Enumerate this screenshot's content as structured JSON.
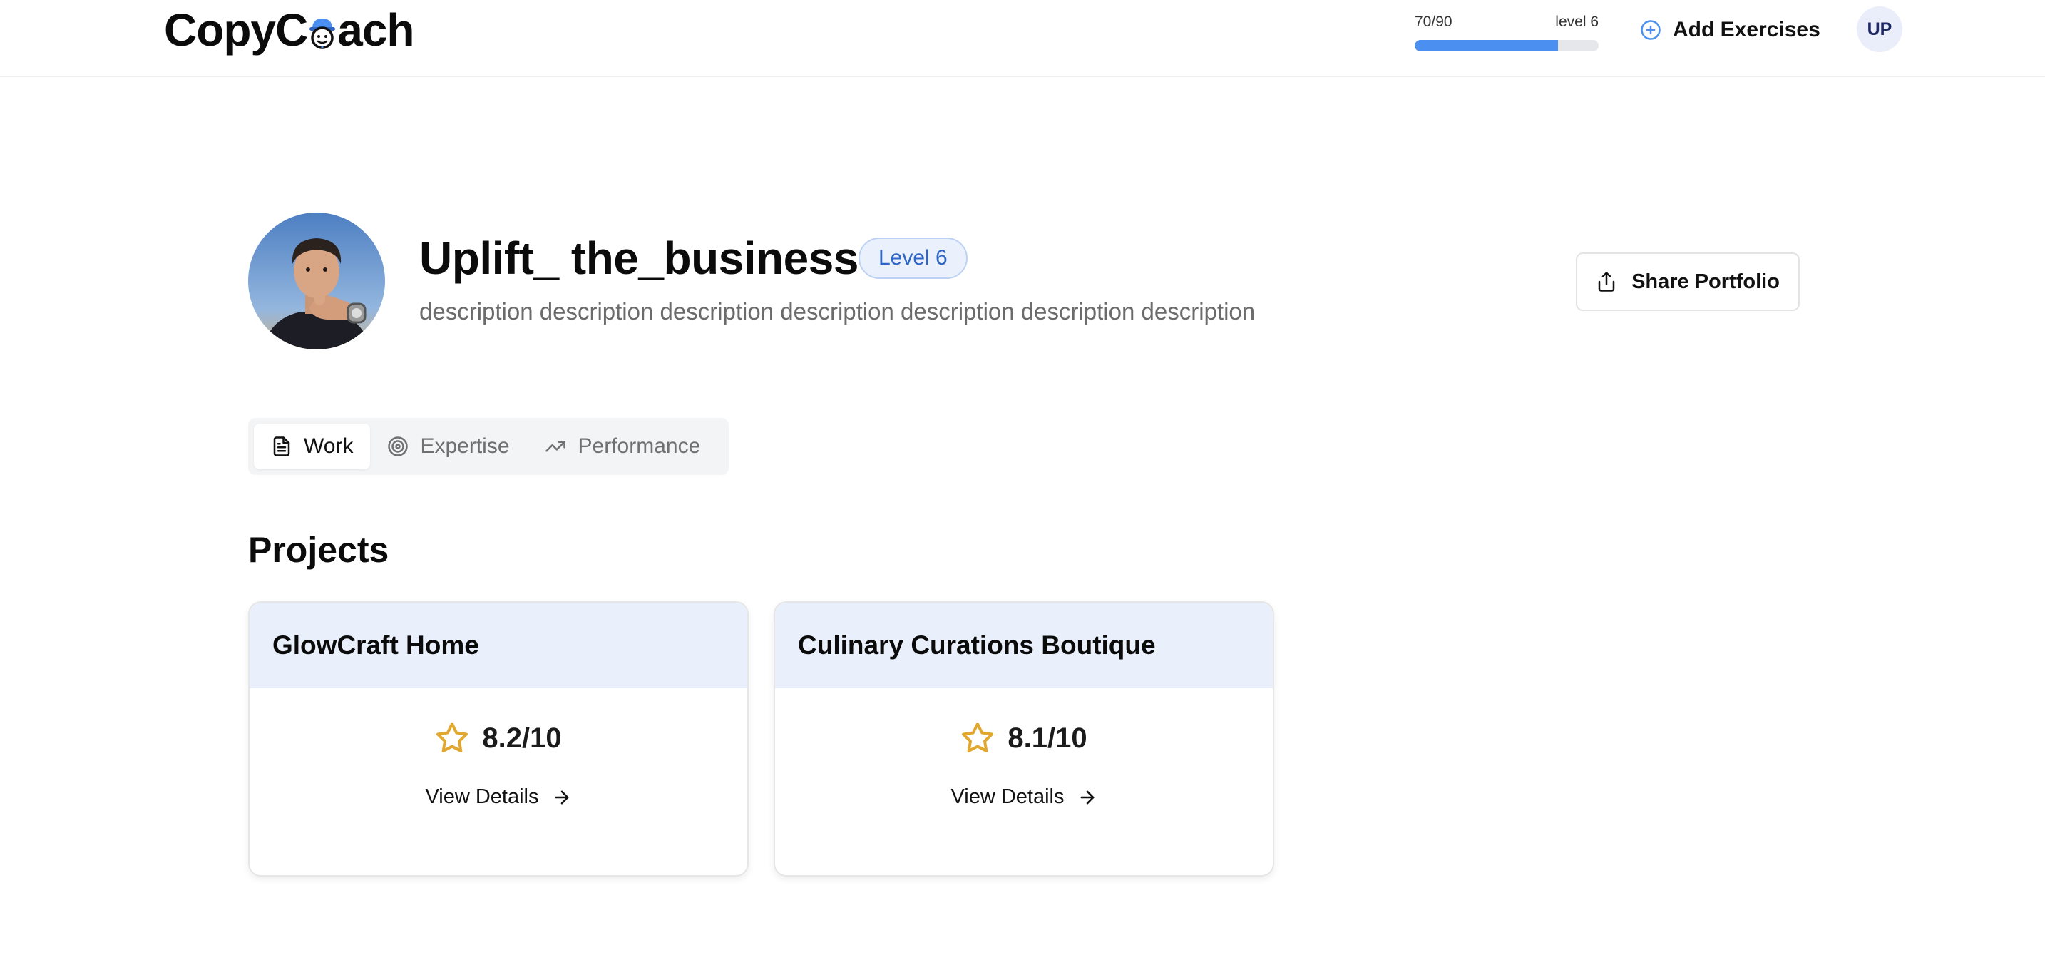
{
  "header": {
    "logo_before": "CopyC",
    "logo_after": "ach",
    "progress": {
      "current_label": "70/90",
      "level_label": "level 6",
      "fraction": 0.78
    },
    "add_exercises_label": "Add Exercises",
    "user_initials": "UP"
  },
  "profile": {
    "name": "Uplift_ the_business",
    "level_badge": "Level 6",
    "description": "description description description description description description description",
    "share_label": "Share Portfolio"
  },
  "tabs": [
    {
      "label": "Work",
      "icon": "document-icon",
      "active": true
    },
    {
      "label": "Expertise",
      "icon": "target-icon",
      "active": false
    },
    {
      "label": "Performance",
      "icon": "trending-up-icon",
      "active": false
    }
  ],
  "projects": {
    "title": "Projects",
    "items": [
      {
        "name": "GlowCraft Home",
        "score": "8.2/10",
        "link_label": "View Details"
      },
      {
        "name": "Culinary Curations Boutique",
        "score": "8.1/10",
        "link_label": "View Details"
      }
    ]
  },
  "colors": {
    "accent": "#4b8ff0",
    "badge_text": "#2d66c4",
    "card_header_bg": "#eaf0fb",
    "star": "#e2a72e"
  }
}
